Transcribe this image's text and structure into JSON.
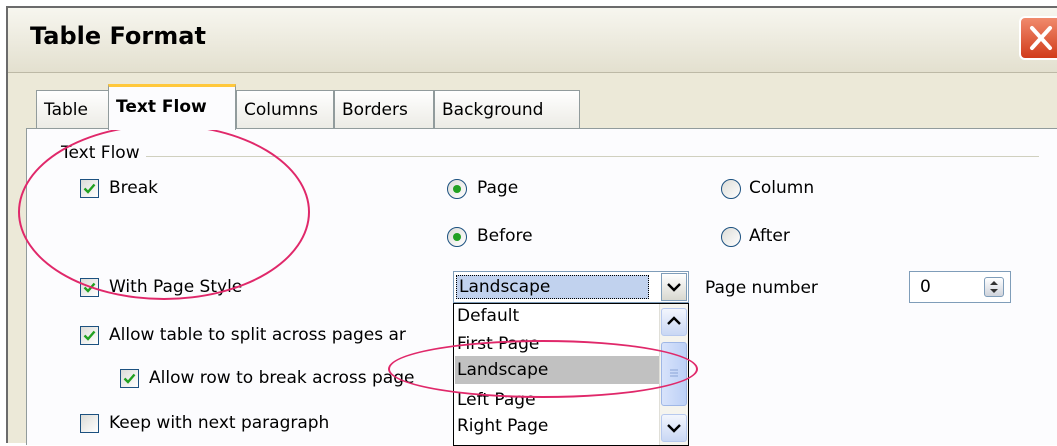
{
  "window": {
    "title": "Table Format"
  },
  "tabs": [
    "Table",
    "Text Flow",
    "Columns",
    "Borders",
    "Background"
  ],
  "active_tab": "Text Flow",
  "text_flow": {
    "group_label": "Text Flow",
    "break": {
      "label": "Break",
      "checked": true
    },
    "break_type": {
      "page": {
        "label": "Page",
        "selected": true
      },
      "column": {
        "label": "Column",
        "selected": false
      }
    },
    "break_position": {
      "before": {
        "label": "Before",
        "selected": true
      },
      "after": {
        "label": "After",
        "selected": false
      }
    },
    "with_page_style": {
      "label": "With Page Style",
      "checked": true
    },
    "page_style": {
      "value": "Landscape",
      "options": [
        "Default",
        "First Page",
        "Landscape",
        "Left Page",
        "Right Page"
      ],
      "highlighted": "Landscape"
    },
    "page_number": {
      "label": "Page number",
      "value": "0"
    },
    "allow_split": {
      "label": "Allow table to split across pages ar",
      "checked": true
    },
    "allow_row_break": {
      "label": "Allow row to break across page",
      "checked": true
    },
    "keep_with_next": {
      "label": "Keep with next paragraph",
      "checked": false
    }
  },
  "colors": {
    "annotation": "#e0286a",
    "radio_dot": "#21a121",
    "active_tab_accent": "#ffc83c"
  }
}
